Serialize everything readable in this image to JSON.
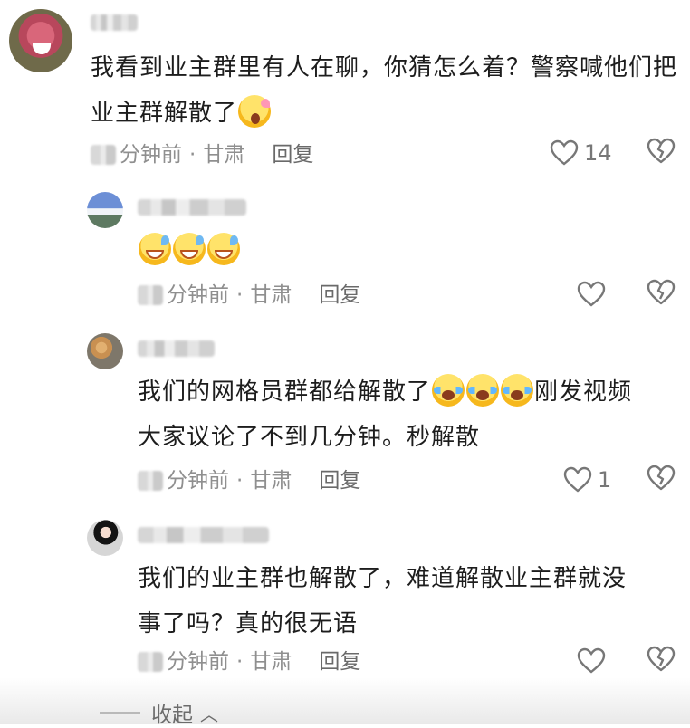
{
  "comments": [
    {
      "text": "我看到业主群里有人在聊，你猜怎么着？警察喊他们把业主群解散了",
      "meta": {
        "time_suffix": "分钟前",
        "location": "甘肃",
        "reply_label": "回复"
      },
      "likes": "14",
      "emoji": "shock-emoji"
    },
    {
      "text": "",
      "meta": {
        "time_suffix": "分钟前",
        "location": "甘肃",
        "reply_label": "回复"
      },
      "likes": "",
      "emoji": "laugh-emoji"
    },
    {
      "text_line1": "我们的网格员群都给解散了",
      "text_line1_tail": "刚发视频",
      "text_line2": "大家议论了不到几分钟。秒解散",
      "meta": {
        "time_suffix": "分钟前",
        "location": "甘肃",
        "reply_label": "回复"
      },
      "likes": "1",
      "emoji": "cry-emoji"
    },
    {
      "text_line1": "我们的业主群也解散了，难道解散业主群就没",
      "text_line2": "事了吗？真的很无语",
      "meta": {
        "time_suffix": "分钟前",
        "location": "甘肃",
        "reply_label": "回复"
      },
      "likes": "",
      "emoji": ""
    }
  ],
  "footer": {
    "collapse_label": "收起"
  },
  "colors": {
    "meta": "#8f8f8f",
    "text": "#1d1d1d",
    "icon": "#777777"
  },
  "icons": [
    "heart-icon",
    "broken-heart-icon",
    "chevron-up-icon"
  ]
}
